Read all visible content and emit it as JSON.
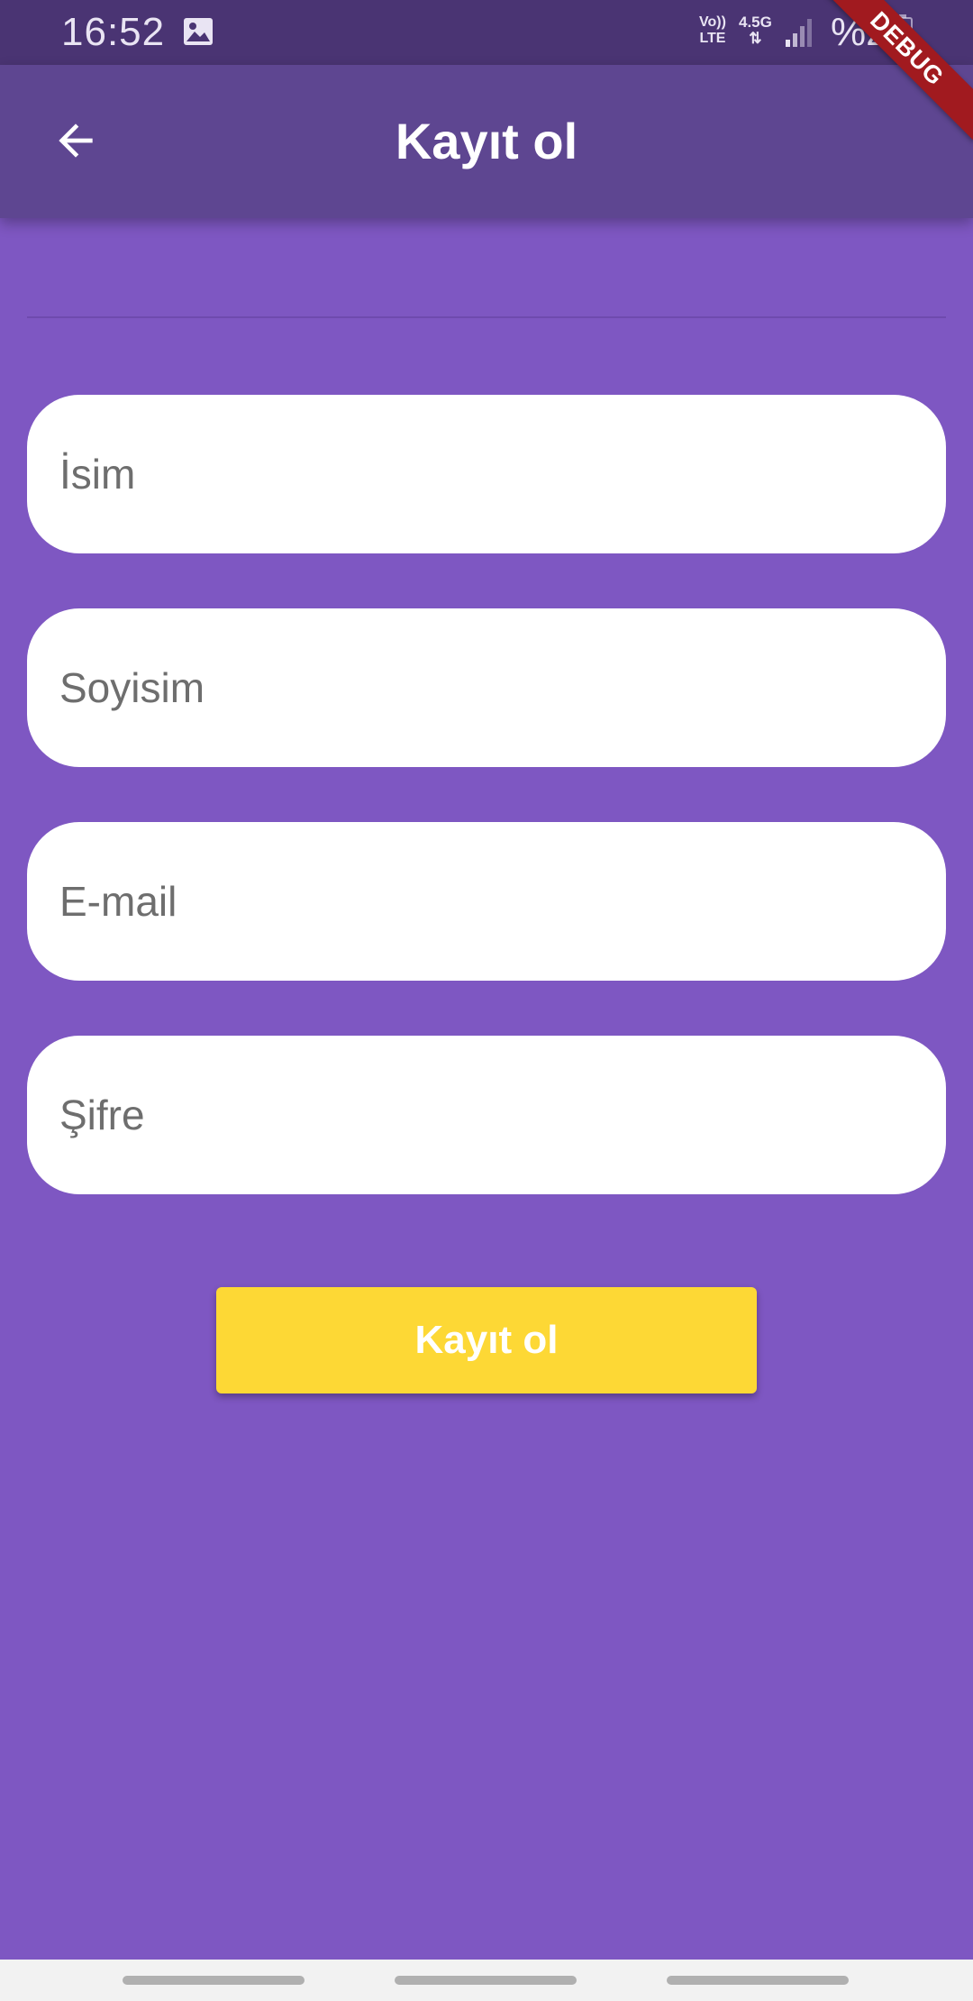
{
  "status_bar": {
    "time": "16:52",
    "network_top": "Vo))",
    "network_bottom": "LTE",
    "data_type": "4.5G",
    "battery_text": "%2",
    "icons": [
      "gallery-icon",
      "signal-icon",
      "battery-icon"
    ]
  },
  "app_bar": {
    "title": "Kayıt ol",
    "back_icon": "arrow-back-icon"
  },
  "debug_banner": {
    "label": "DEBUG"
  },
  "form": {
    "name_placeholder": "İsim",
    "surname_placeholder": "Soyisim",
    "email_placeholder": "E-mail",
    "password_placeholder": "Şifre",
    "submit_label": "Kayıt ol"
  },
  "colors": {
    "background": "#7E57C2",
    "app_bar": "#5E4691",
    "status_bar": "#4A3473",
    "button": "#FDD835",
    "debug_banner": "#A11A1F"
  }
}
